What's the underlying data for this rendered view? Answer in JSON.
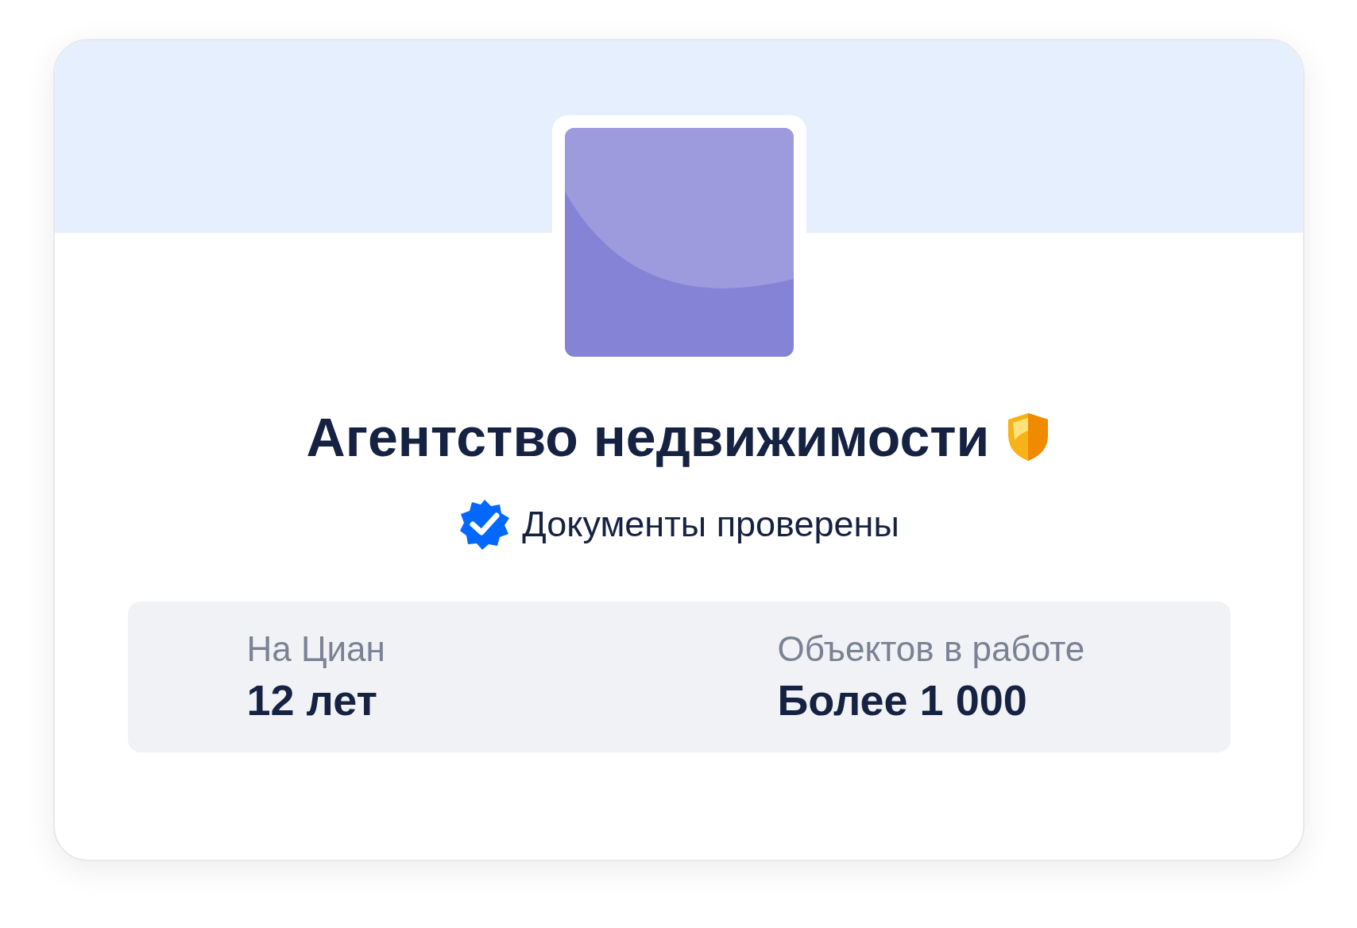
{
  "agency": {
    "name": "Агентство недвижимости",
    "trusted": true
  },
  "verification": {
    "text": "Документы проверены",
    "verified": true
  },
  "stats": [
    {
      "label": "На Циан",
      "value": "12 лет"
    },
    {
      "label": "Объектов в работе",
      "value": "Более 1 000"
    }
  ]
}
